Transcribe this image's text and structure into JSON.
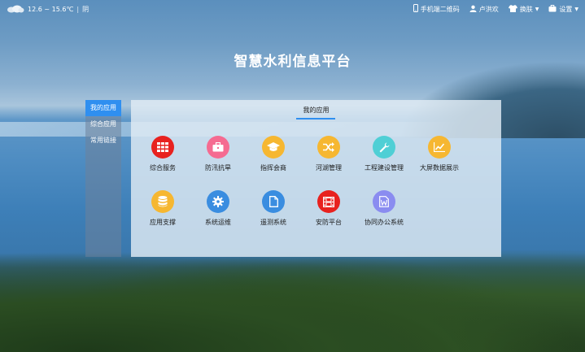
{
  "weather": {
    "temp": "12.6 ~ 15.6℃",
    "separator": "|",
    "condition": "阴"
  },
  "topbar": {
    "qr_label": "手机端二维码",
    "user_label": "卢洪欢",
    "skin_label": "换肤",
    "settings_label": "设置"
  },
  "title": "智慧水利信息平台",
  "sidebar": {
    "items": [
      {
        "label": "我的应用"
      },
      {
        "label": "综合应用"
      },
      {
        "label": "常用链接"
      }
    ]
  },
  "panel": {
    "tab_label": "我的应用",
    "apps": [
      {
        "label": "综合服务",
        "icon": "grid-icon",
        "color": "#e8221f"
      },
      {
        "label": "防汛抗旱",
        "icon": "briefcase-icon",
        "color": "#f56b91"
      },
      {
        "label": "指挥会商",
        "icon": "graduation-cap-icon",
        "color": "#f6b731"
      },
      {
        "label": "河湖管理",
        "icon": "shuffle-icon",
        "color": "#f6b731"
      },
      {
        "label": "工程建设管理",
        "icon": "wrench-icon",
        "color": "#4fcfd5"
      },
      {
        "label": "大屏数据展示",
        "icon": "line-chart-icon",
        "color": "#f6b731"
      },
      {
        "label": "应用支撑",
        "icon": "database-icon",
        "color": "#f6b731"
      },
      {
        "label": "系统运维",
        "icon": "gear-icon",
        "color": "#3a8de0"
      },
      {
        "label": "遥测系统",
        "icon": "document-icon",
        "color": "#3a8de0"
      },
      {
        "label": "安防平台",
        "icon": "film-icon",
        "color": "#e8221f"
      },
      {
        "label": "协同办公系统",
        "icon": "word-doc-icon",
        "color": "#8a8cf0"
      }
    ]
  }
}
